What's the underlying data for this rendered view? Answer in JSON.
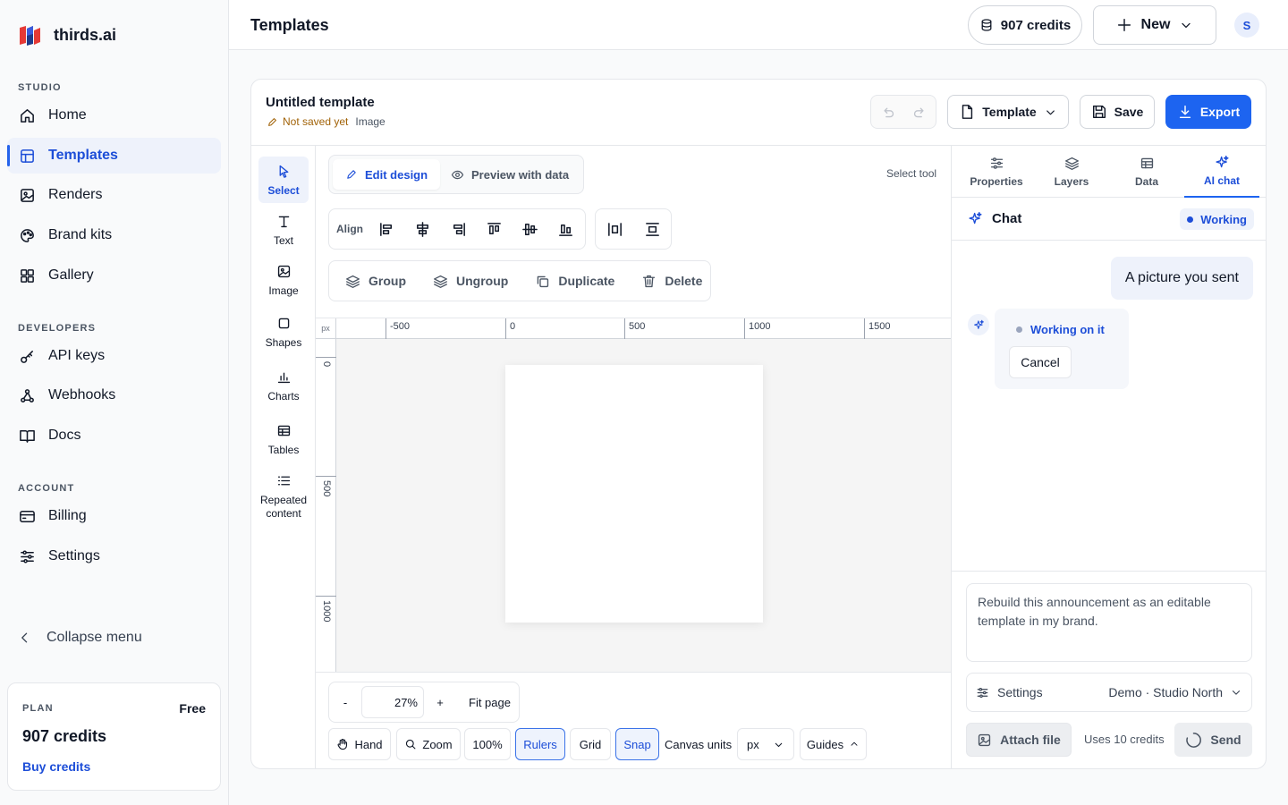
{
  "brand": {
    "name": "thirds.ai"
  },
  "sidebar": {
    "sections": {
      "studio": "STUDIO",
      "developers": "DEVELOPERS",
      "account": "ACCOUNT"
    },
    "items": [
      {
        "label": "Home",
        "icon": "home-icon"
      },
      {
        "label": "Templates",
        "icon": "template-icon",
        "active": true
      },
      {
        "label": "Renders",
        "icon": "image-icon"
      },
      {
        "label": "Brand kits",
        "icon": "palette-icon"
      },
      {
        "label": "Gallery",
        "icon": "grid-icon"
      },
      {
        "label": "API keys",
        "icon": "key-icon"
      },
      {
        "label": "Webhooks",
        "icon": "webhook-icon"
      },
      {
        "label": "Docs",
        "icon": "book-icon"
      },
      {
        "label": "Billing",
        "icon": "card-icon"
      },
      {
        "label": "Settings",
        "icon": "sliders-icon"
      }
    ],
    "collapse_label": "Collapse menu",
    "plan": {
      "label": "PLAN",
      "tier": "Free",
      "credits": "907 credits",
      "buy": "Buy credits"
    }
  },
  "header": {
    "title": "Templates",
    "credits": "907 credits",
    "new_label": "New",
    "avatar_initial": "S"
  },
  "editor": {
    "template_name": "Untitled template",
    "status": "Not saved yet",
    "kind": "Image",
    "template_menu": "Template",
    "save": "Save",
    "export": "Export",
    "tools": [
      {
        "label": "Select",
        "icon": "pointer-icon",
        "active": true
      },
      {
        "label": "Text",
        "icon": "text-icon"
      },
      {
        "label": "Image",
        "icon": "image-icon"
      },
      {
        "label": "Shapes",
        "icon": "square-icon"
      },
      {
        "label": "Charts",
        "icon": "bar-chart-icon"
      },
      {
        "label": "Tables",
        "icon": "table-icon"
      },
      {
        "label": "Repeated content",
        "icon": "list-icon"
      }
    ],
    "modes": {
      "edit": "Edit design",
      "preview": "Preview with data"
    },
    "hint": "Select tool",
    "align_label": "Align",
    "group_actions": {
      "group": "Group",
      "ungroup": "Ungroup",
      "duplicate": "Duplicate",
      "delete": "Delete"
    },
    "ruler": {
      "unit": "px",
      "h_ticks": [
        "-500",
        "0",
        "500",
        "1000",
        "1500"
      ],
      "v_ticks": [
        "0",
        "500",
        "1000"
      ]
    },
    "zoom": {
      "minus": "-",
      "value": "27%",
      "plus": "+",
      "fit": "Fit page"
    },
    "bottom": {
      "hand": "Hand",
      "zoom": "Zoom",
      "hundred": "100%",
      "rulers": "Rulers",
      "grid": "Grid",
      "snap": "Snap",
      "canvas_units_label": "Canvas units",
      "canvas_units_value": "px",
      "guides": "Guides"
    }
  },
  "right_panel": {
    "tabs": [
      {
        "label": "Properties",
        "icon": "sliders-icon"
      },
      {
        "label": "Layers",
        "icon": "layers-icon"
      },
      {
        "label": "Data",
        "icon": "table-icon"
      },
      {
        "label": "AI chat",
        "icon": "sparkle-icon",
        "active": true
      }
    ],
    "chat_title": "Chat",
    "status_badge": "Working",
    "user_message": "A picture you sent",
    "bot_status": "Working on it",
    "cancel": "Cancel",
    "prompt_text": "Rebuild this announcement as an editable template in my brand.",
    "settings_label": "Settings",
    "settings_value": "Demo · Studio North",
    "attach": "Attach file",
    "uses": "Uses 10 credits",
    "send": "Send"
  },
  "colors": {
    "accent": "#1d64f0",
    "active_bg": "#eef2fb",
    "warning": "#a16207"
  }
}
